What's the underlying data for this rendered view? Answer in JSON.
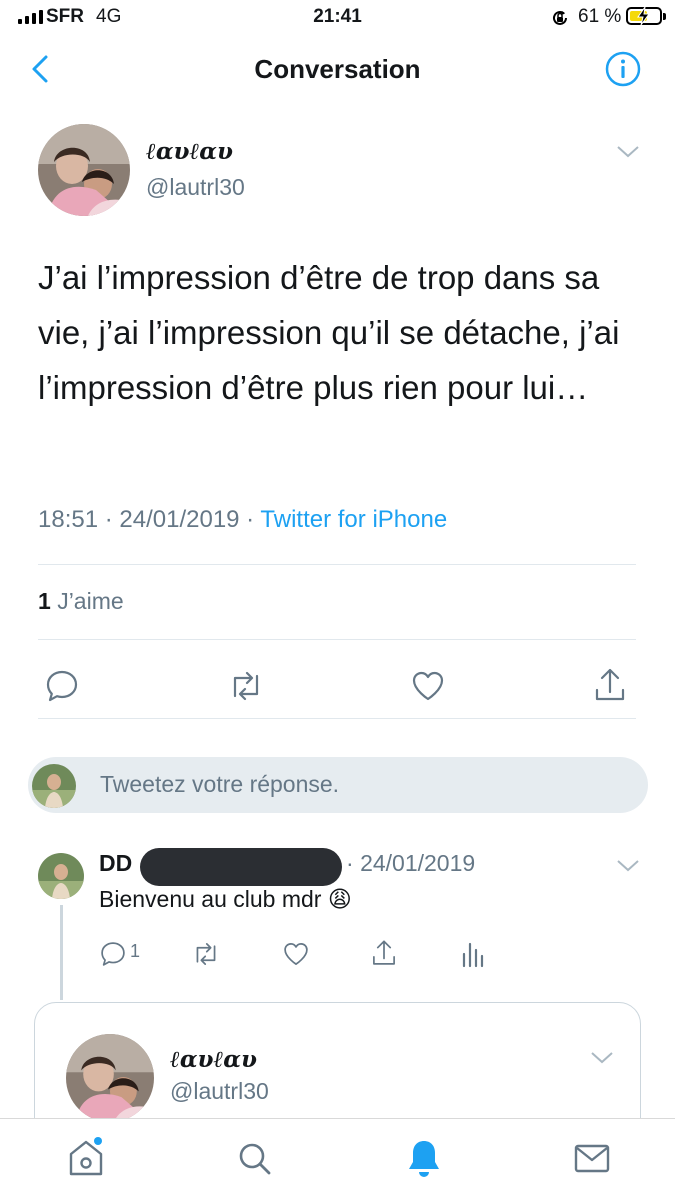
{
  "status_bar": {
    "carrier": "SFR",
    "network": "4G",
    "time": "21:41",
    "battery_percent": "61 %",
    "battery_level": 0.61,
    "icons": [
      "signal-icon",
      "rotation-lock-icon",
      "battery-icon",
      "charging-bolt-icon"
    ]
  },
  "header": {
    "title": "Conversation",
    "icons": [
      "back-chevron-icon",
      "info-icon"
    ]
  },
  "main_tweet": {
    "display_name": "ℓαυℓαυ",
    "handle": "@lautrl30",
    "text": "J’ai l’impression d’être de trop dans sa vie, j’ai l’impression qu’il se détache, j’ai l’impression d’être plus rien pour lui…",
    "time": "18:51",
    "date": "24/01/2019",
    "source": "Twitter for iPhone",
    "likes_count": "1",
    "likes_label": "J’aime",
    "actions": [
      "reply-icon",
      "retweet-icon",
      "like-icon",
      "share-icon"
    ]
  },
  "composer": {
    "placeholder": "Tweetez votre réponse."
  },
  "reply": {
    "display_name": "DD",
    "date": "24/01/2019",
    "text": "Bienvenu au club mdr 😩",
    "reply_count": "1",
    "actions": [
      "reply-icon",
      "retweet-icon",
      "like-icon",
      "share-icon",
      "analytics-icon"
    ]
  },
  "quoted": {
    "display_name": "ℓαυℓαυ",
    "handle": "@lautrl30"
  },
  "tab_bar": {
    "tabs": [
      "home-icon",
      "search-icon",
      "notifications-icon",
      "messages-icon"
    ],
    "active": "notifications-icon",
    "accent": "#1da1f2"
  },
  "colors": {
    "accent": "#1da1f2",
    "secondary_text": "#657786",
    "divider": "#e1e8ed"
  }
}
